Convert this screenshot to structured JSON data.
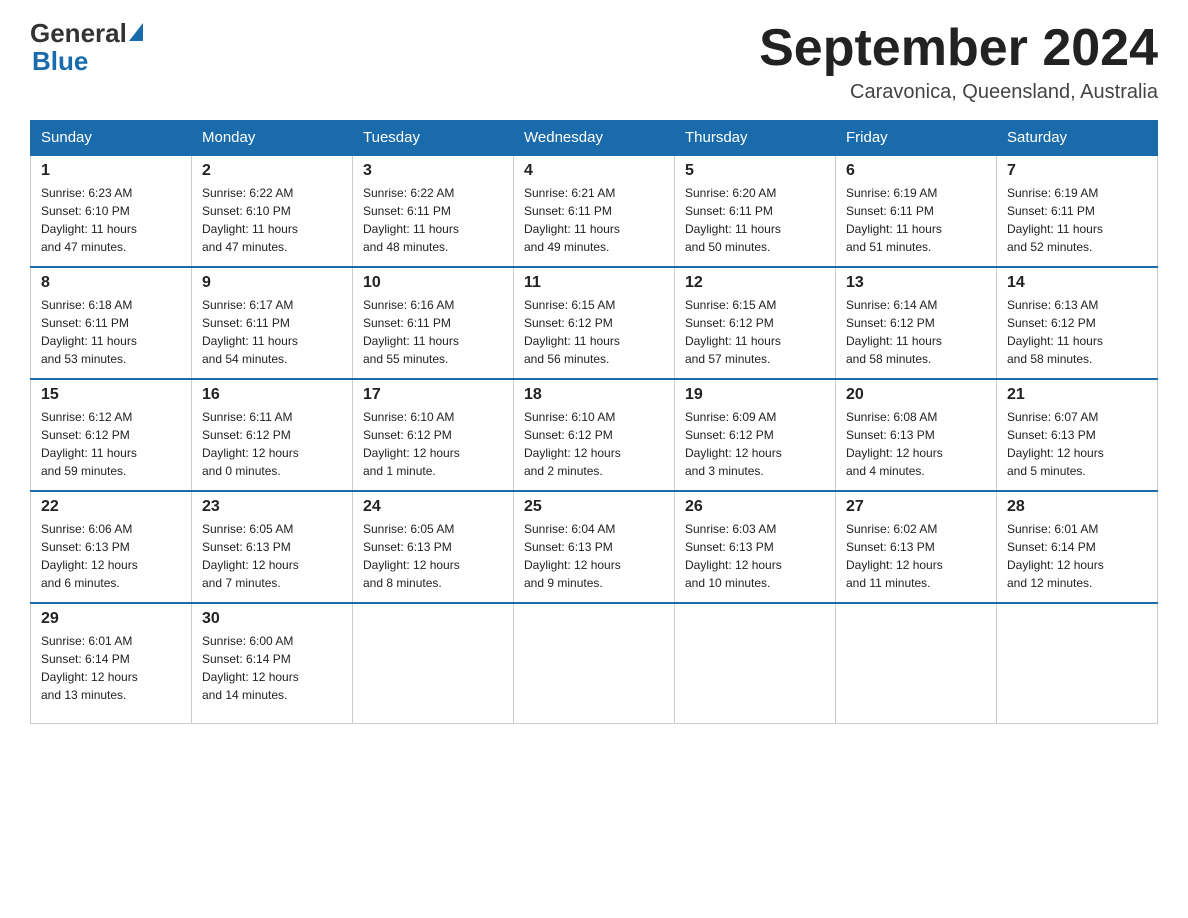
{
  "header": {
    "logo_general": "General",
    "logo_blue": "Blue",
    "month_title": "September 2024",
    "location": "Caravonica, Queensland, Australia"
  },
  "days_of_week": [
    "Sunday",
    "Monday",
    "Tuesday",
    "Wednesday",
    "Thursday",
    "Friday",
    "Saturday"
  ],
  "weeks": [
    [
      {
        "day": "1",
        "sunrise": "6:23 AM",
        "sunset": "6:10 PM",
        "daylight": "11 hours and 47 minutes."
      },
      {
        "day": "2",
        "sunrise": "6:22 AM",
        "sunset": "6:10 PM",
        "daylight": "11 hours and 47 minutes."
      },
      {
        "day": "3",
        "sunrise": "6:22 AM",
        "sunset": "6:11 PM",
        "daylight": "11 hours and 48 minutes."
      },
      {
        "day": "4",
        "sunrise": "6:21 AM",
        "sunset": "6:11 PM",
        "daylight": "11 hours and 49 minutes."
      },
      {
        "day": "5",
        "sunrise": "6:20 AM",
        "sunset": "6:11 PM",
        "daylight": "11 hours and 50 minutes."
      },
      {
        "day": "6",
        "sunrise": "6:19 AM",
        "sunset": "6:11 PM",
        "daylight": "11 hours and 51 minutes."
      },
      {
        "day": "7",
        "sunrise": "6:19 AM",
        "sunset": "6:11 PM",
        "daylight": "11 hours and 52 minutes."
      }
    ],
    [
      {
        "day": "8",
        "sunrise": "6:18 AM",
        "sunset": "6:11 PM",
        "daylight": "11 hours and 53 minutes."
      },
      {
        "day": "9",
        "sunrise": "6:17 AM",
        "sunset": "6:11 PM",
        "daylight": "11 hours and 54 minutes."
      },
      {
        "day": "10",
        "sunrise": "6:16 AM",
        "sunset": "6:11 PM",
        "daylight": "11 hours and 55 minutes."
      },
      {
        "day": "11",
        "sunrise": "6:15 AM",
        "sunset": "6:12 PM",
        "daylight": "11 hours and 56 minutes."
      },
      {
        "day": "12",
        "sunrise": "6:15 AM",
        "sunset": "6:12 PM",
        "daylight": "11 hours and 57 minutes."
      },
      {
        "day": "13",
        "sunrise": "6:14 AM",
        "sunset": "6:12 PM",
        "daylight": "11 hours and 58 minutes."
      },
      {
        "day": "14",
        "sunrise": "6:13 AM",
        "sunset": "6:12 PM",
        "daylight": "11 hours and 58 minutes."
      }
    ],
    [
      {
        "day": "15",
        "sunrise": "6:12 AM",
        "sunset": "6:12 PM",
        "daylight": "11 hours and 59 minutes."
      },
      {
        "day": "16",
        "sunrise": "6:11 AM",
        "sunset": "6:12 PM",
        "daylight": "12 hours and 0 minutes."
      },
      {
        "day": "17",
        "sunrise": "6:10 AM",
        "sunset": "6:12 PM",
        "daylight": "12 hours and 1 minute."
      },
      {
        "day": "18",
        "sunrise": "6:10 AM",
        "sunset": "6:12 PM",
        "daylight": "12 hours and 2 minutes."
      },
      {
        "day": "19",
        "sunrise": "6:09 AM",
        "sunset": "6:12 PM",
        "daylight": "12 hours and 3 minutes."
      },
      {
        "day": "20",
        "sunrise": "6:08 AM",
        "sunset": "6:13 PM",
        "daylight": "12 hours and 4 minutes."
      },
      {
        "day": "21",
        "sunrise": "6:07 AM",
        "sunset": "6:13 PM",
        "daylight": "12 hours and 5 minutes."
      }
    ],
    [
      {
        "day": "22",
        "sunrise": "6:06 AM",
        "sunset": "6:13 PM",
        "daylight": "12 hours and 6 minutes."
      },
      {
        "day": "23",
        "sunrise": "6:05 AM",
        "sunset": "6:13 PM",
        "daylight": "12 hours and 7 minutes."
      },
      {
        "day": "24",
        "sunrise": "6:05 AM",
        "sunset": "6:13 PM",
        "daylight": "12 hours and 8 minutes."
      },
      {
        "day": "25",
        "sunrise": "6:04 AM",
        "sunset": "6:13 PM",
        "daylight": "12 hours and 9 minutes."
      },
      {
        "day": "26",
        "sunrise": "6:03 AM",
        "sunset": "6:13 PM",
        "daylight": "12 hours and 10 minutes."
      },
      {
        "day": "27",
        "sunrise": "6:02 AM",
        "sunset": "6:13 PM",
        "daylight": "12 hours and 11 minutes."
      },
      {
        "day": "28",
        "sunrise": "6:01 AM",
        "sunset": "6:14 PM",
        "daylight": "12 hours and 12 minutes."
      }
    ],
    [
      {
        "day": "29",
        "sunrise": "6:01 AM",
        "sunset": "6:14 PM",
        "daylight": "12 hours and 13 minutes."
      },
      {
        "day": "30",
        "sunrise": "6:00 AM",
        "sunset": "6:14 PM",
        "daylight": "12 hours and 14 minutes."
      },
      null,
      null,
      null,
      null,
      null
    ]
  ]
}
